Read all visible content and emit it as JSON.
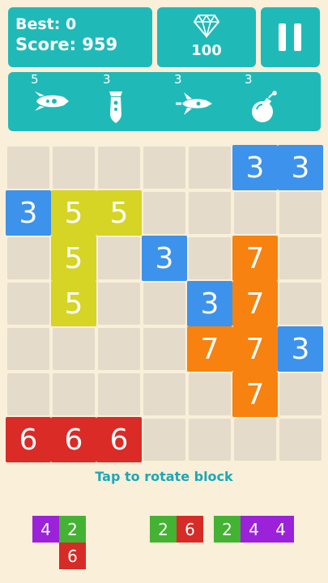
{
  "header": {
    "best_label": "Best: 0",
    "score_label": "Score: 959",
    "gems": "100",
    "gem_icon": "diamond-icon",
    "pause_icon": "pause-icon"
  },
  "powerups": [
    {
      "count": "5",
      "icon": "rocket-icon"
    },
    {
      "count": "3",
      "icon": "missile-icon"
    },
    {
      "count": "3",
      "icon": "twin-rocket-icon"
    },
    {
      "count": "3",
      "icon": "bomb-icon"
    }
  ],
  "board": {
    "rows": 7,
    "cols": 7,
    "tiles": [
      [
        null,
        null,
        null,
        null,
        null,
        3,
        3
      ],
      [
        3,
        5,
        5,
        null,
        null,
        null,
        null
      ],
      [
        null,
        5,
        null,
        3,
        null,
        7,
        null
      ],
      [
        null,
        5,
        null,
        null,
        3,
        7,
        null
      ],
      [
        null,
        null,
        null,
        null,
        7,
        7,
        3
      ],
      [
        null,
        null,
        null,
        null,
        null,
        7,
        null
      ],
      [
        6,
        6,
        6,
        null,
        null,
        null,
        null
      ]
    ]
  },
  "hint": "Tap to rotate block",
  "pieces": [
    [
      [
        4,
        2
      ],
      [
        null,
        6
      ]
    ],
    [
      [
        2,
        6
      ]
    ],
    [
      [
        2,
        4,
        4
      ]
    ]
  ],
  "colors": {
    "panel": "#1fbab8",
    "background": "#faefd9",
    "empty_cell": "#e5dbca",
    "tile_3": "#3d92ec",
    "tile_5": "#d6d424",
    "tile_7": "#f7820f",
    "tile_6": "#da2b27",
    "piece_4": "#9b22d8",
    "piece_2": "#44b233",
    "piece_6": "#d62b26",
    "hint_text": "#1ba8b5"
  }
}
